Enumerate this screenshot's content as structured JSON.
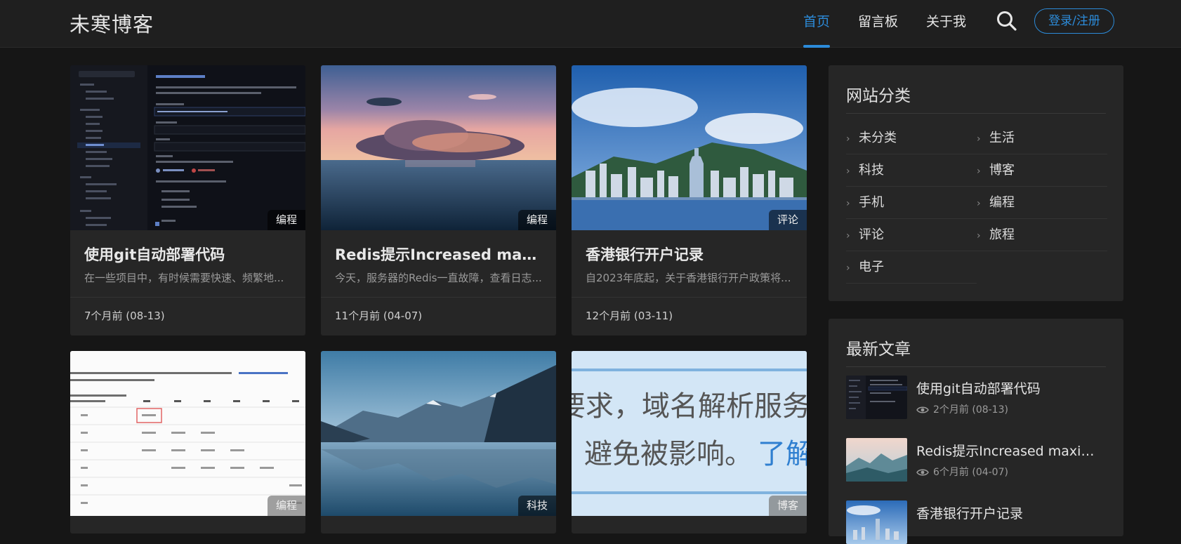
{
  "site": {
    "logo": "未寒博客"
  },
  "nav": {
    "items": [
      "首页",
      "留言板",
      "关于我"
    ],
    "active": "首页",
    "login_label": "登录/注册",
    "search_icon": "search-icon"
  },
  "colors": {
    "accent": "#2c8bd9",
    "background": "#161616",
    "card": "#262626"
  },
  "cards": [
    {
      "tag": "编程",
      "title": "使用git自动部署代码",
      "desc": "在一些项目中，有时候需要快速、频繁地...",
      "time": "7个月前 (08-13)"
    },
    {
      "tag": "编程",
      "title": "Redis提示Increased maxim...",
      "desc": "今天，服务器的Redis一直故障，查看日志...",
      "time": "11个月前 (04-07)"
    },
    {
      "tag": "评论",
      "title": "香港银行开户记录",
      "desc": "自2023年底起，关于香港银行开户政策将...",
      "time": "12个月前 (03-11)"
    },
    {
      "tag": "编程"
    },
    {
      "tag": "科技"
    },
    {
      "tag": "博客"
    }
  ],
  "thumb_texts": {
    "card6_line1": "要求，域名解析服务提",
    "card6_line2": "避免被影响。",
    "card6_link": "了解"
  },
  "sidebar": {
    "categories_title": "网站分类",
    "categories": [
      "未分类",
      "生活",
      "科技",
      "博客",
      "手机",
      "编程",
      "评论",
      "旅程",
      "电子"
    ],
    "recent_title": "最新文章",
    "recent": [
      {
        "title": "使用git自动部署代码",
        "meta": "2个月前 (08-13)"
      },
      {
        "title": "Redis提示Increased maximu...",
        "meta": "6个月前 (04-07)"
      },
      {
        "title": "香港银行开户记录"
      }
    ]
  }
}
